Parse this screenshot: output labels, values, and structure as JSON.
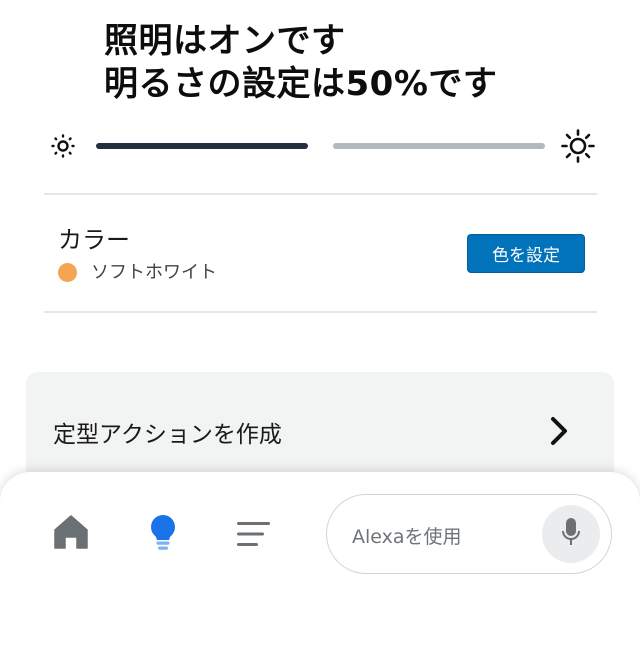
{
  "header": {
    "line1": "照明はオンです",
    "line2": "明るさの設定は50%です"
  },
  "brightness": {
    "level_percent": 50,
    "low_icon": "sun-small-icon",
    "high_icon": "sun-large-icon"
  },
  "color_section": {
    "title": "カラー",
    "current_value": "ソフトホワイト",
    "swatch_color": "#f5a452",
    "button_label": "色を設定"
  },
  "routine": {
    "label": "定型アクションを作成",
    "icon": "chevron-right-icon"
  },
  "bottom_bar": {
    "home_icon": "home-icon",
    "devices_icon": "lightbulb-icon",
    "menu_icon": "menu-icon",
    "alexa_placeholder": "Alexaを使用",
    "mic_icon": "microphone-icon"
  },
  "colors": {
    "accent": "#0073bb",
    "active_nav": "#1a73e8",
    "slider_fill": "#232f3e",
    "slider_rest": "#b4b9be"
  }
}
